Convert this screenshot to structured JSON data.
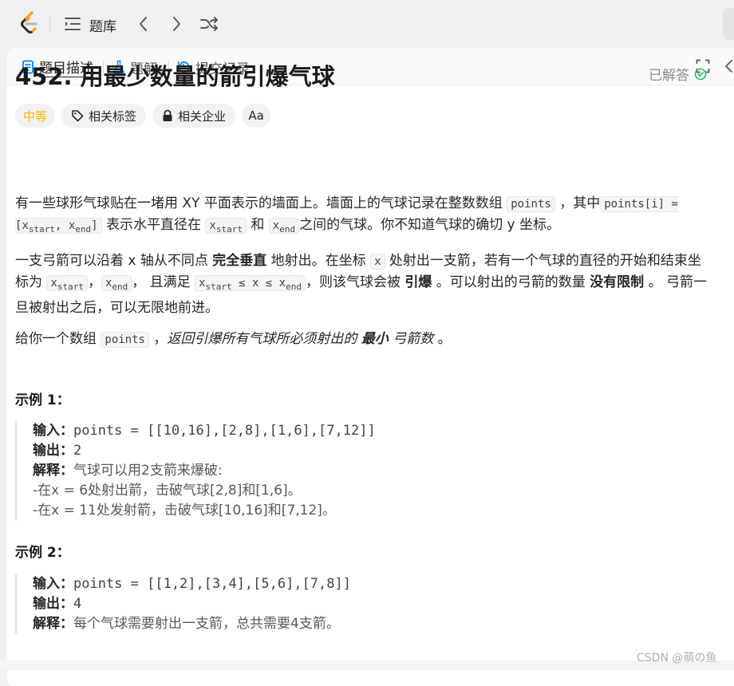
{
  "topbar": {
    "title": "题库",
    "icons": [
      "leetcode-logo",
      "list-icon",
      "chevron-left-icon",
      "chevron-right-icon",
      "shuffle-icon"
    ]
  },
  "tabs": [
    {
      "label": "题目描述",
      "icon": "description-icon",
      "color": "#1890ff"
    },
    {
      "label": "题解",
      "icon": "flask-icon",
      "color": "#1890ff"
    },
    {
      "label": "提交记录",
      "icon": "history-icon",
      "color": "#1890ff"
    }
  ],
  "problem": {
    "title": "452. 用最少数量的箭引爆气球",
    "status": "已解答",
    "status_color": "#2db55d",
    "difficulty": "中等",
    "difficulty_color": "#ffb800",
    "tags": [
      "相关标签",
      "相关企业",
      "Aa"
    ],
    "p1": {
      "a": "有一些球形气球贴在一堵用 XY 平面表示的墙面上。墙面上的气球记录在整数数组 ",
      "code1": "points",
      "b": " ，其中",
      "code2": "points[i] = [x",
      "code2_sub1": "start",
      "code2_mid": ", x",
      "code2_sub2": "end",
      "code2_end": "]",
      "c": " 表示水平直径在 ",
      "code3": "x",
      "code3_sub": "start",
      "d": " 和 ",
      "code4": "x",
      "code4_sub": "end",
      "e": "之间的气球。你不知道气球的确切 y 坐标。"
    },
    "p2": {
      "a": "一支弓箭可以沿着 x 轴从不同点 ",
      "b1": "完全垂直",
      "b": " 地射出。在坐标 ",
      "code1": "x",
      "c": " 处射出一支箭，若有一个气球的直径的开始和结束坐标为 ",
      "code2": "x",
      "code2_sub": "start",
      "d": "，",
      "code3": "x",
      "code3_sub": "end",
      "e": "， 且满足  ",
      "code4": "x",
      "code4_sub": "start",
      "code4_rest": " ≤ x ≤ x",
      "code4_sub2": "end",
      "f": "，则该气球会被 ",
      "b2": "引爆",
      "g": " 。可以射出的弓箭的数量 ",
      "b3": "没有限制",
      "h": " 。 弓箭一旦被射出之后，可以无限地前进。"
    },
    "p3": {
      "a": "给你一个数组 ",
      "code1": "points",
      "b": " ，",
      "i1": "返回引爆所有气球所必须射出的 ",
      "b1": "最小",
      "i2": " 弓箭数",
      "c": " 。"
    }
  },
  "examples": [
    {
      "heading": "示例 1：",
      "input_label": "输入：",
      "input": "points = [[10,16],[2,8],[1,6],[7,12]]",
      "output_label": "输出：",
      "output": "2",
      "explain_label": "解释：",
      "explain": "气球可以用2支箭来爆破:",
      "lines": [
        "-在x = 6处射出箭，击破气球[2,8]和[1,6]。",
        "-在x = 11处发射箭，击破气球[10,16]和[7,12]。"
      ]
    },
    {
      "heading": "示例 2：",
      "input_label": "输入：",
      "input": "points = [[1,2],[3,4],[5,6],[7,8]]",
      "output_label": "输出：",
      "output": "4",
      "explain_label": "解释：",
      "explain": "每个气球需要射出一支箭，总共需要4支箭。"
    }
  ],
  "watermark": "CSDN @萌の鱼"
}
